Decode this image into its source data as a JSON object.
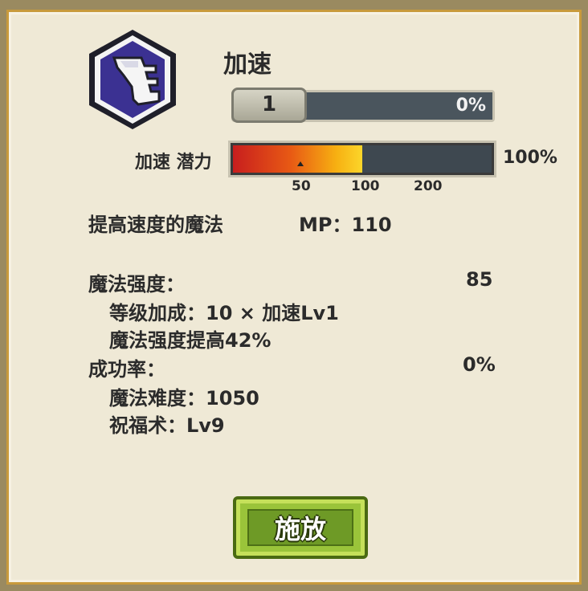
{
  "skill": {
    "name": "加速",
    "icon": "speed-boot-icon",
    "level": "1",
    "level_progress_label": "0%",
    "level_progress": 0.0
  },
  "potential": {
    "label": "加速 潜力",
    "percent_label": "100%",
    "fill_fraction": 0.5,
    "ticks": [
      "50",
      "100",
      "200"
    ]
  },
  "description": {
    "text": "提高速度的魔法",
    "mp": "MP：110"
  },
  "stats": {
    "power_label": "魔法强度：",
    "power_value": "85",
    "level_bonus": "等级加成：10 × 加速Lv1",
    "power_boost": "魔法强度提高42%",
    "success_label": "成功率：",
    "success_value": "0%",
    "difficulty": "魔法难度：1050",
    "blessing": "祝福术：Lv9"
  },
  "cast_button": {
    "label": "施放"
  },
  "colors": {
    "panel_bg": "#efe9d6",
    "panel_border": "#c89a3c",
    "icon_bg": "#3a2f8a",
    "button_green": "#9ac43a"
  }
}
